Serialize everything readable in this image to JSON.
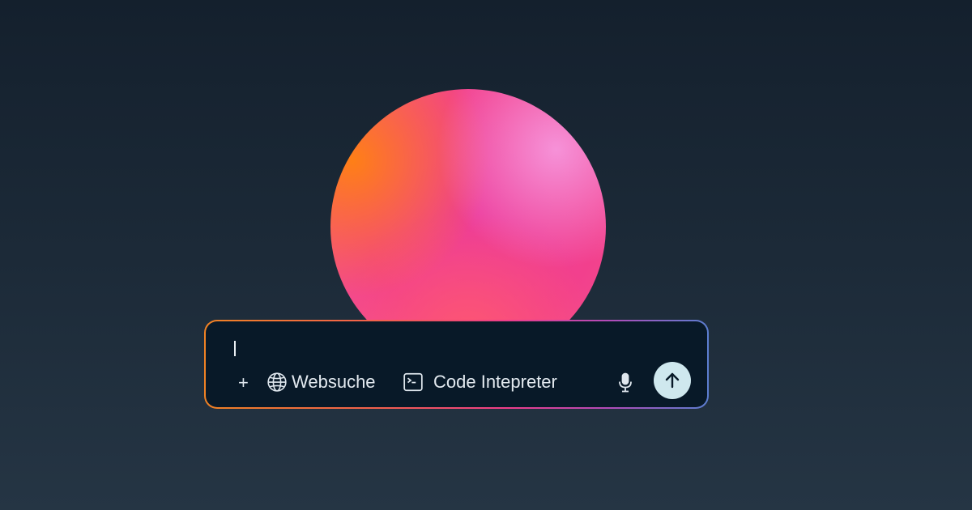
{
  "composer": {
    "input_value": "",
    "add_label": "+",
    "web_search_label": "Websuche",
    "code_interpreter_label": "Code Intepreter"
  },
  "icons": {
    "web_search": "globe-icon",
    "code_interpreter": "terminal-icon",
    "voice": "microphone-icon",
    "send": "arrow-up-icon"
  },
  "colors": {
    "background_top": "#14202d",
    "background_bottom": "#253544",
    "composer_bg": "#081928",
    "border_gradient": [
      "#f08224",
      "#ee3d8a",
      "#5b7ed0"
    ],
    "send_button": "#cfe8ee",
    "orb_core": "#ec3a9a",
    "orb_orange": "#ff8014",
    "orb_pink": "#f696dc"
  }
}
